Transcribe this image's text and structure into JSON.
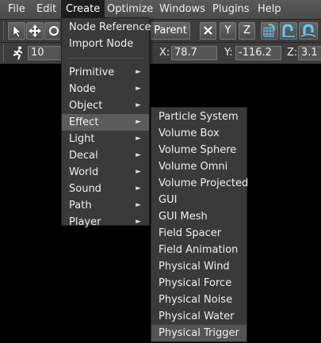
{
  "menubar": {
    "items": [
      "File",
      "Edit",
      "Create",
      "Optimize",
      "Windows",
      "Plugins",
      "Help"
    ]
  },
  "toolbar": {
    "parent_label": "Parent",
    "axis_x": "X",
    "axis_y": "Y",
    "axis_z": "Z",
    "step_value": "10",
    "coord_x_label": "X:",
    "coord_x_value": "78.7",
    "coord_y_label": "Y:",
    "coord_y_value": "-116.2",
    "coord_z_label": "Z:",
    "coord_z_value": "3.1"
  },
  "create_menu": {
    "top_items": [
      "Node Reference",
      "Import Node"
    ],
    "sub_items": [
      "Primitive",
      "Node",
      "Object",
      "Effect",
      "Light",
      "Decal",
      "World",
      "Sound",
      "Path",
      "Player"
    ],
    "highlighted": "Effect"
  },
  "effect_submenu": {
    "items": [
      "Particle System",
      "Volume Box",
      "Volume Sphere",
      "Volume Omni",
      "Volume Projected",
      "GUI",
      "GUI Mesh",
      "Field Spacer",
      "Field Animation",
      "Physical Wind",
      "Physical Force",
      "Physical Noise",
      "Physical Water",
      "Physical Trigger"
    ],
    "highlighted": "Physical Trigger"
  },
  "icons": {
    "submenu_arrow": "►"
  }
}
